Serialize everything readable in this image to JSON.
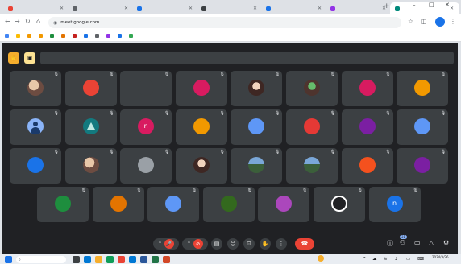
{
  "browser": {
    "tabs": [
      {
        "title": "",
        "active": false,
        "color": "#ea4335"
      },
      {
        "title": "",
        "active": false,
        "color": "#5f6368"
      },
      {
        "title": "",
        "active": false,
        "color": "#1a73e8"
      },
      {
        "title": "",
        "active": false,
        "color": "#3c4043"
      },
      {
        "title": "",
        "active": false,
        "color": "#1a73e8"
      },
      {
        "title": "",
        "active": false,
        "color": "#9334e6"
      },
      {
        "title": "",
        "active": true,
        "color": "#00897b"
      }
    ],
    "new_tab_icon": "plus-icon",
    "url": "meet.google.com",
    "bookmarks": [
      {
        "label": "",
        "color": "#4285f4"
      },
      {
        "label": "",
        "color": "#fbbc04"
      },
      {
        "label": "",
        "color": "#f29900"
      },
      {
        "label": "",
        "color": "#f29900"
      },
      {
        "label": "",
        "color": "#1e8e3e"
      },
      {
        "label": "",
        "color": "#e37400"
      },
      {
        "label": "",
        "color": "#c5221f"
      },
      {
        "label": "",
        "color": "#1a73e8"
      },
      {
        "label": "",
        "color": "#5f6368"
      },
      {
        "label": "",
        "color": "#9334e6"
      },
      {
        "label": "",
        "color": "#1a73e8"
      },
      {
        "label": "",
        "color": "#34a853"
      }
    ]
  },
  "meet": {
    "banner_text": "",
    "banner_actions": [
      "",
      ""
    ],
    "participants": [
      {
        "name": "",
        "avatar": "",
        "type": "photo",
        "color": "#6d4c41"
      },
      {
        "name": "",
        "avatar": "",
        "type": "text",
        "color": "#ea4335"
      },
      {
        "name": "",
        "avatar": "",
        "type": "text",
        "color": "#3c4043"
      },
      {
        "name": "",
        "avatar": "",
        "type": "text",
        "color": "#d81b60"
      },
      {
        "name": "",
        "avatar": "",
        "type": "girl",
        "color": "#f1d3bd"
      },
      {
        "name": "",
        "avatar": "",
        "type": "plant",
        "color": "#4e342e"
      },
      {
        "name": "",
        "avatar": "",
        "type": "text",
        "color": "#d81b60"
      },
      {
        "name": "",
        "avatar": "",
        "type": "text",
        "color": "#f29900"
      },
      {
        "name": "",
        "avatar": "",
        "type": "person",
        "color": "#8ab4f8"
      },
      {
        "name": "",
        "avatar": "",
        "type": "teal",
        "color": "#137a7f"
      },
      {
        "name": "",
        "avatar": "n",
        "type": "letter",
        "color": "#d81b60"
      },
      {
        "name": "",
        "avatar": "",
        "type": "text",
        "color": "#f29900"
      },
      {
        "name": "",
        "avatar": "",
        "type": "text",
        "color": "#5e97f6"
      },
      {
        "name": "",
        "avatar": "",
        "type": "text",
        "color": "#e53935"
      },
      {
        "name": "",
        "avatar": "",
        "type": "text",
        "color": "#7b1fa2"
      },
      {
        "name": "",
        "avatar": "",
        "type": "text",
        "color": "#5e97f6"
      },
      {
        "name": "",
        "avatar": "",
        "type": "text",
        "color": "#1a73e8"
      },
      {
        "name": "",
        "avatar": "",
        "type": "photo",
        "color": "#6d4c41"
      },
      {
        "name": "",
        "avatar": "",
        "type": "grey",
        "color": "#9aa0a6"
      },
      {
        "name": "",
        "avatar": "",
        "type": "girl",
        "color": "#f1d3bd"
      },
      {
        "name": "",
        "avatar": "",
        "type": "mountain",
        "color": "#3b5f3a"
      },
      {
        "name": "",
        "avatar": "",
        "type": "mountain",
        "color": "#7aa7d8"
      },
      {
        "name": "",
        "avatar": "",
        "type": "text",
        "color": "#f4511e"
      },
      {
        "name": "",
        "avatar": "",
        "type": "text",
        "color": "#7b1fa2"
      },
      {
        "name": "",
        "avatar": "",
        "type": "text",
        "color": "#1e8e3e"
      },
      {
        "name": "",
        "avatar": "",
        "type": "text",
        "color": "#e37400"
      },
      {
        "name": "",
        "avatar": "",
        "type": "text",
        "color": "#5e97f6"
      },
      {
        "name": "",
        "avatar": "",
        "type": "text",
        "color": "#33691e"
      },
      {
        "name": "",
        "avatar": "",
        "type": "text",
        "color": "#ab47bc"
      },
      {
        "name": "",
        "avatar": "",
        "type": "blackwhite",
        "color": "#202124"
      },
      {
        "name": "",
        "avatar": "n",
        "type": "letter",
        "color": "#1a73e8"
      }
    ],
    "meeting_info": "",
    "participant_count": "31"
  },
  "taskbar": {
    "search_placeholder": "",
    "weather_line1": "",
    "weather_line2": "",
    "time": "",
    "date": "2024/3/26"
  },
  "colors": {
    "meet_bg": "#202124",
    "tile_bg": "#3c4043",
    "accent": "#8ab4f8",
    "leave": "#ea4335"
  }
}
